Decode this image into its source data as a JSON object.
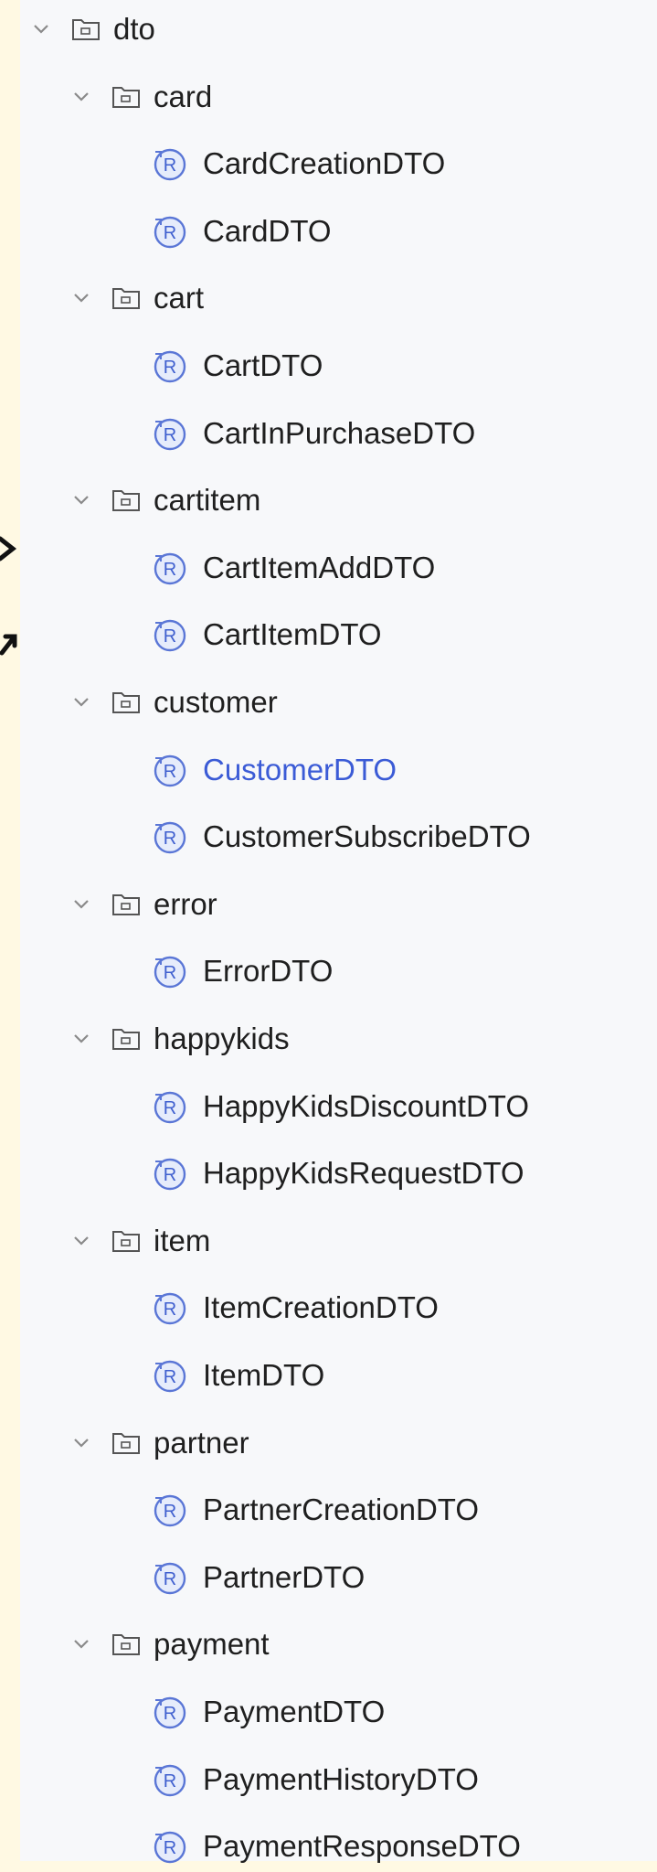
{
  "colors": {
    "background": "#fff9e3",
    "panel": "#f7f8fa",
    "text": "#1f1f1f",
    "selected": "#3b5bd6",
    "icon": "#5a76d6"
  },
  "tree": {
    "root": {
      "label": "dto",
      "icon": "folder-icon",
      "expanded": true
    },
    "packages": [
      {
        "label": "card",
        "expanded": true,
        "records": [
          "CardCreationDTO",
          "CardDTO"
        ]
      },
      {
        "label": "cart",
        "expanded": true,
        "records": [
          "CartDTO",
          "CartInPurchaseDTO"
        ]
      },
      {
        "label": "cartitem",
        "expanded": true,
        "records": [
          "CartItemAddDTO",
          "CartItemDTO"
        ]
      },
      {
        "label": "customer",
        "expanded": true,
        "records": [
          "CustomerDTO",
          "CustomerSubscribeDTO"
        ]
      },
      {
        "label": "error",
        "expanded": true,
        "records": [
          "ErrorDTO"
        ]
      },
      {
        "label": "happykids",
        "expanded": true,
        "records": [
          "HappyKidsDiscountDTO",
          "HappyKidsRequestDTO"
        ]
      },
      {
        "label": "item",
        "expanded": true,
        "records": [
          "ItemCreationDTO",
          "ItemDTO"
        ]
      },
      {
        "label": "partner",
        "expanded": true,
        "records": [
          "PartnerCreationDTO",
          "PartnerDTO"
        ]
      },
      {
        "label": "payment",
        "expanded": true,
        "records": [
          "PaymentDTO",
          "PaymentHistoryDTO",
          "PaymentResponseDTO"
        ]
      }
    ],
    "selected_record": "CustomerDTO"
  }
}
